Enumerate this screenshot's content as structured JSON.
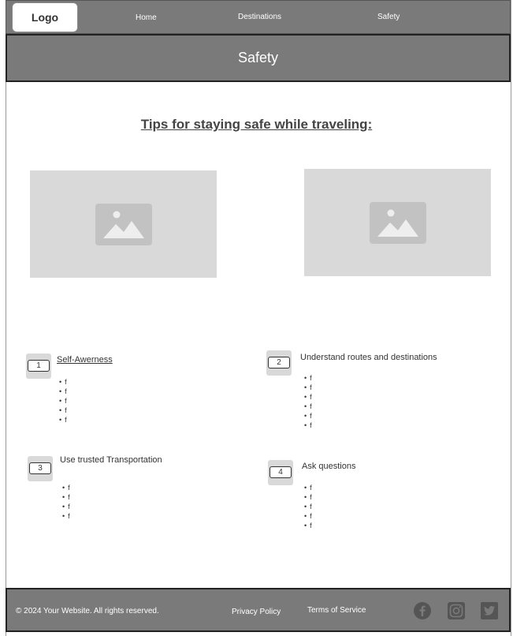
{
  "nav": {
    "logo": "Logo",
    "links": [
      "Home",
      "Destinations",
      "Safety"
    ]
  },
  "hero": {
    "title": "Safety"
  },
  "main": {
    "heading": "Tips for staying safe while traveling:",
    "tips": [
      {
        "number": "1",
        "title": "Self-Awerness",
        "bullets": [
          "f",
          "f",
          "f",
          "f",
          "f"
        ]
      },
      {
        "number": "2",
        "title": "Understand routes and destinations",
        "bullets": [
          "f",
          "f",
          "f",
          "f",
          "f",
          "f"
        ]
      },
      {
        "number": "3",
        "title": "Use trusted Transportation",
        "bullets": [
          "f",
          "f",
          "f",
          "f"
        ]
      },
      {
        "number": "4",
        "title": "Ask questions",
        "bullets": [
          "f",
          "f",
          "f",
          "f",
          "f"
        ]
      }
    ]
  },
  "footer": {
    "copyright": "© 2024 Your Website. All rights reserved.",
    "privacy": "Privacy Policy",
    "terms": "Terms of Service",
    "social_icons": [
      "facebook-icon",
      "instagram-icon",
      "twitter-icon"
    ]
  },
  "colors": {
    "header_bg": "#7a7a7a",
    "placeholder_bg": "#d9d9d9",
    "icon_gray": "#555555"
  }
}
